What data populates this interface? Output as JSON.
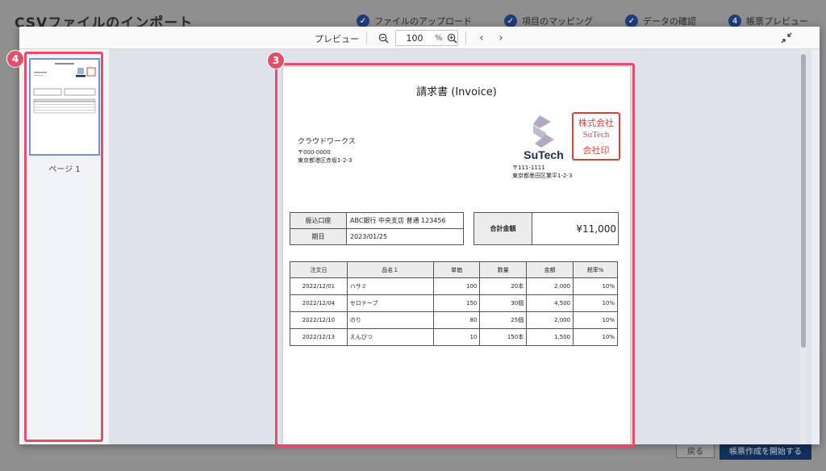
{
  "background": {
    "title": "CSVファイルのインポート",
    "steps": [
      {
        "label": "ファイルのアップロード"
      },
      {
        "label": "項目のマッピング"
      },
      {
        "label": "データの確認"
      },
      {
        "label": "帳票プレビュー"
      }
    ],
    "back_label": "戻る",
    "next_label": "帳票作成を開始する"
  },
  "toolbar": {
    "title": "プレビュー",
    "zoom_value": "100",
    "zoom_unit": "%"
  },
  "thumbnails": {
    "caption": "ページ 1"
  },
  "invoice": {
    "title": "請求書 (Invoice)",
    "customer": {
      "name": "クラウドワークス",
      "zip": "〒000-0000",
      "address": "東京都港区赤坂1-2-3"
    },
    "company": {
      "logo": "SuTech",
      "zip": "〒111-1111",
      "address": "東京都墨田区業平1-2-3"
    },
    "seal": [
      "株式会社",
      "SuTech",
      "会社印"
    ],
    "bank_label": "振込口座",
    "bank_value": "ABC銀行 中央支店 普通 123456",
    "due_label": "期日",
    "due_value": "2023/01/25",
    "total_label": "合計金額",
    "total_value": "¥11,000",
    "headers": [
      "注文日",
      "品名１",
      "単価",
      "数量",
      "金額",
      "税率%"
    ],
    "rows": [
      [
        "2022/12/01",
        "ハサミ",
        "100",
        "20本",
        "2,000",
        "10%"
      ],
      [
        "2022/12/04",
        "セロテープ",
        "150",
        "30個",
        "4,500",
        "10%"
      ],
      [
        "2022/12/10",
        "のり",
        "80",
        "25個",
        "2,000",
        "10%"
      ],
      [
        "2022/12/13",
        "えんぴつ",
        "10",
        "150本",
        "1,500",
        "10%"
      ]
    ]
  },
  "annotations": [
    {
      "label": "4"
    },
    {
      "label": "3"
    }
  ],
  "colors": {
    "annotation": "#e0506a",
    "brand": "#1c2b52",
    "seal": "#d9453d",
    "primary": "#12305e"
  }
}
